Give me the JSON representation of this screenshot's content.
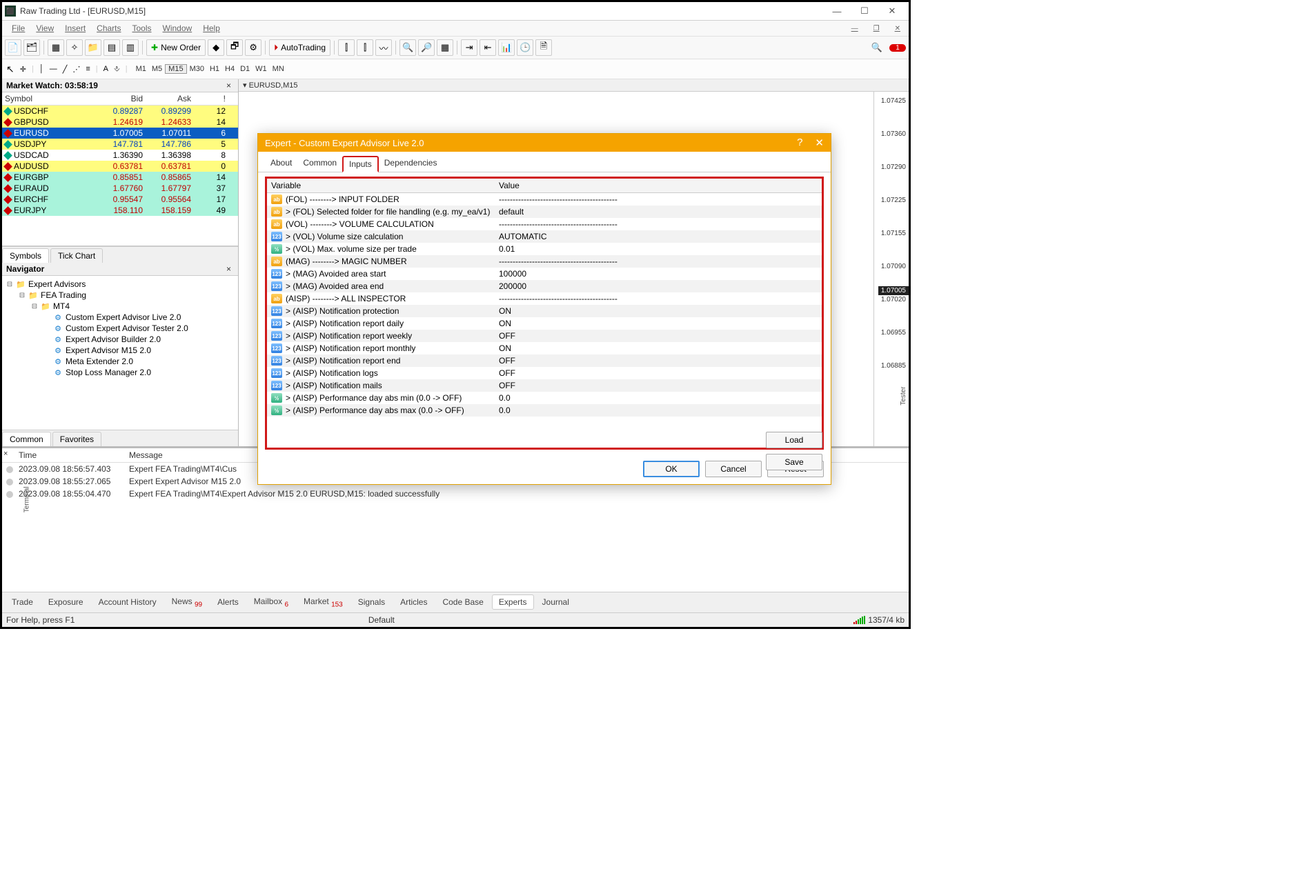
{
  "window": {
    "title": "Raw Trading Ltd - [EURUSD,M15]",
    "chart_label": "▾ EURUSD,M15"
  },
  "menu": [
    "File",
    "View",
    "Insert",
    "Charts",
    "Tools",
    "Window",
    "Help"
  ],
  "toolbar": {
    "new_order": "New Order",
    "auto_trading": "AutoTrading",
    "notif_count": "1"
  },
  "timeframes": [
    "M1",
    "M5",
    "M15",
    "M30",
    "H1",
    "H4",
    "D1",
    "W1",
    "MN"
  ],
  "market_watch": {
    "title": "Market Watch: 03:58:19",
    "headers": [
      "Symbol",
      "Bid",
      "Ask",
      "!"
    ],
    "rows": [
      {
        "sym": "USDCHF",
        "bid": "0.89287",
        "ask": "0.89299",
        "sp": "12",
        "cls": "yellow",
        "bidc": "blue",
        "askc": "blue",
        "d": "#0a8"
      },
      {
        "sym": "GBPUSD",
        "bid": "1.24619",
        "ask": "1.24633",
        "sp": "14",
        "cls": "yellow",
        "bidc": "red",
        "askc": "red",
        "d": "#c00"
      },
      {
        "sym": "EURUSD",
        "bid": "1.07005",
        "ask": "1.07011",
        "sp": "6",
        "cls": "sel",
        "bidc": "",
        "askc": "",
        "d": "#c00"
      },
      {
        "sym": "USDJPY",
        "bid": "147.781",
        "ask": "147.786",
        "sp": "5",
        "cls": "yellow",
        "bidc": "blue",
        "askc": "blue",
        "d": "#0a8"
      },
      {
        "sym": "USDCAD",
        "bid": "1.36390",
        "ask": "1.36398",
        "sp": "8",
        "cls": "",
        "bidc": "",
        "askc": "",
        "d": "#0a8"
      },
      {
        "sym": "AUDUSD",
        "bid": "0.63781",
        "ask": "0.63781",
        "sp": "0",
        "cls": "yellow",
        "bidc": "red",
        "askc": "red",
        "d": "#c00"
      },
      {
        "sym": "EURGBP",
        "bid": "0.85851",
        "ask": "0.85865",
        "sp": "14",
        "cls": "teal",
        "bidc": "red",
        "askc": "red",
        "d": "#c00"
      },
      {
        "sym": "EURAUD",
        "bid": "1.67760",
        "ask": "1.67797",
        "sp": "37",
        "cls": "teal",
        "bidc": "red",
        "askc": "red",
        "d": "#c00"
      },
      {
        "sym": "EURCHF",
        "bid": "0.95547",
        "ask": "0.95564",
        "sp": "17",
        "cls": "teal",
        "bidc": "red",
        "askc": "red",
        "d": "#c00"
      },
      {
        "sym": "EURJPY",
        "bid": "158.110",
        "ask": "158.159",
        "sp": "49",
        "cls": "teal",
        "bidc": "red",
        "askc": "red",
        "d": "#c00"
      }
    ],
    "tabs": [
      "Symbols",
      "Tick Chart"
    ]
  },
  "navigator": {
    "title": "Navigator",
    "root": "Expert Advisors",
    "folder": "FEA Trading",
    "subfolder": "MT4",
    "items": [
      "Custom Expert Advisor Live 2.0",
      "Custom Expert Advisor Tester 2.0",
      "Expert Advisor Builder 2.0",
      "Expert Advisor M15 2.0",
      "Meta Extender 2.0",
      "Stop Loss Manager 2.0"
    ],
    "tabs": [
      "Common",
      "Favorites"
    ]
  },
  "yaxis": [
    "1.07425",
    "1.07360",
    "1.07290",
    "1.07225",
    "1.07155",
    "1.07090",
    "1.07020",
    "1.06955",
    "1.06885"
  ],
  "price_current": "1.07005",
  "dialog": {
    "title": "Expert - Custom Expert Advisor Live 2.0",
    "tabs": [
      "About",
      "Common",
      "Inputs",
      "Dependencies"
    ],
    "headers": [
      "Variable",
      "Value"
    ],
    "rows": [
      {
        "t": "ab",
        "var": "(FOL) --------> INPUT FOLDER",
        "val": "-------------------------------------------"
      },
      {
        "t": "ab",
        "var": "> (FOL) Selected folder for file handling (e.g. my_ea/v1)",
        "val": "default"
      },
      {
        "t": "ab",
        "var": "(VOL) --------> VOLUME CALCULATION",
        "val": "-------------------------------------------"
      },
      {
        "t": "n",
        "var": "> (VOL) Volume size calculation",
        "val": "AUTOMATIC"
      },
      {
        "t": "h",
        "var": "> (VOL) Max. volume size per trade",
        "val": "0.01"
      },
      {
        "t": "ab",
        "var": "(MAG) --------> MAGIC NUMBER",
        "val": "-------------------------------------------"
      },
      {
        "t": "n",
        "var": "> (MAG) Avoided area start",
        "val": "100000"
      },
      {
        "t": "n",
        "var": "> (MAG) Avoided area end",
        "val": "200000"
      },
      {
        "t": "ab",
        "var": "(AISP) --------> ALL INSPECTOR",
        "val": "-------------------------------------------"
      },
      {
        "t": "n",
        "var": "> (AISP) Notification protection",
        "val": "ON"
      },
      {
        "t": "n",
        "var": "> (AISP) Notification report daily",
        "val": "ON"
      },
      {
        "t": "n",
        "var": "> (AISP) Notification report weekly",
        "val": "OFF"
      },
      {
        "t": "n",
        "var": "> (AISP) Notification report monthly",
        "val": "ON"
      },
      {
        "t": "n",
        "var": "> (AISP) Notification report end",
        "val": "OFF"
      },
      {
        "t": "n",
        "var": "> (AISP) Notification logs",
        "val": "OFF"
      },
      {
        "t": "n",
        "var": "> (AISP) Notification mails",
        "val": "OFF"
      },
      {
        "t": "h",
        "var": "> (AISP) Performance day abs min (0.0 -> OFF)",
        "val": "0.0"
      },
      {
        "t": "h",
        "var": "> (AISP) Performance day abs max (0.0 -> OFF)",
        "val": "0.0"
      }
    ],
    "buttons": {
      "load": "Load",
      "save": "Save",
      "ok": "OK",
      "cancel": "Cancel",
      "reset": "Reset"
    }
  },
  "terminal": {
    "headers": [
      "Time",
      "Message"
    ],
    "rows": [
      {
        "time": "2023.09.08 18:56:57.403",
        "msg": "Expert FEA Trading\\MT4\\Cus"
      },
      {
        "time": "2023.09.08 18:55:27.065",
        "msg": "Expert Expert Advisor M15 2.0"
      },
      {
        "time": "2023.09.08 18:55:04.470",
        "msg": "Expert FEA Trading\\MT4\\Expert Advisor M15 2.0 EURUSD,M15: loaded successfully"
      }
    ],
    "tabs": [
      {
        "label": "Trade"
      },
      {
        "label": "Exposure"
      },
      {
        "label": "Account History"
      },
      {
        "label": "News",
        "badge": "99"
      },
      {
        "label": "Alerts"
      },
      {
        "label": "Mailbox",
        "badge": "6"
      },
      {
        "label": "Market",
        "badge": "153"
      },
      {
        "label": "Signals"
      },
      {
        "label": "Articles"
      },
      {
        "label": "Code Base"
      },
      {
        "label": "Experts",
        "active": true
      },
      {
        "label": "Journal"
      }
    ],
    "side_label": "Terminal",
    "tester_label": "Tester"
  },
  "status": {
    "help": "For Help, press F1",
    "profile": "Default",
    "conn": "1357/4 kb"
  }
}
